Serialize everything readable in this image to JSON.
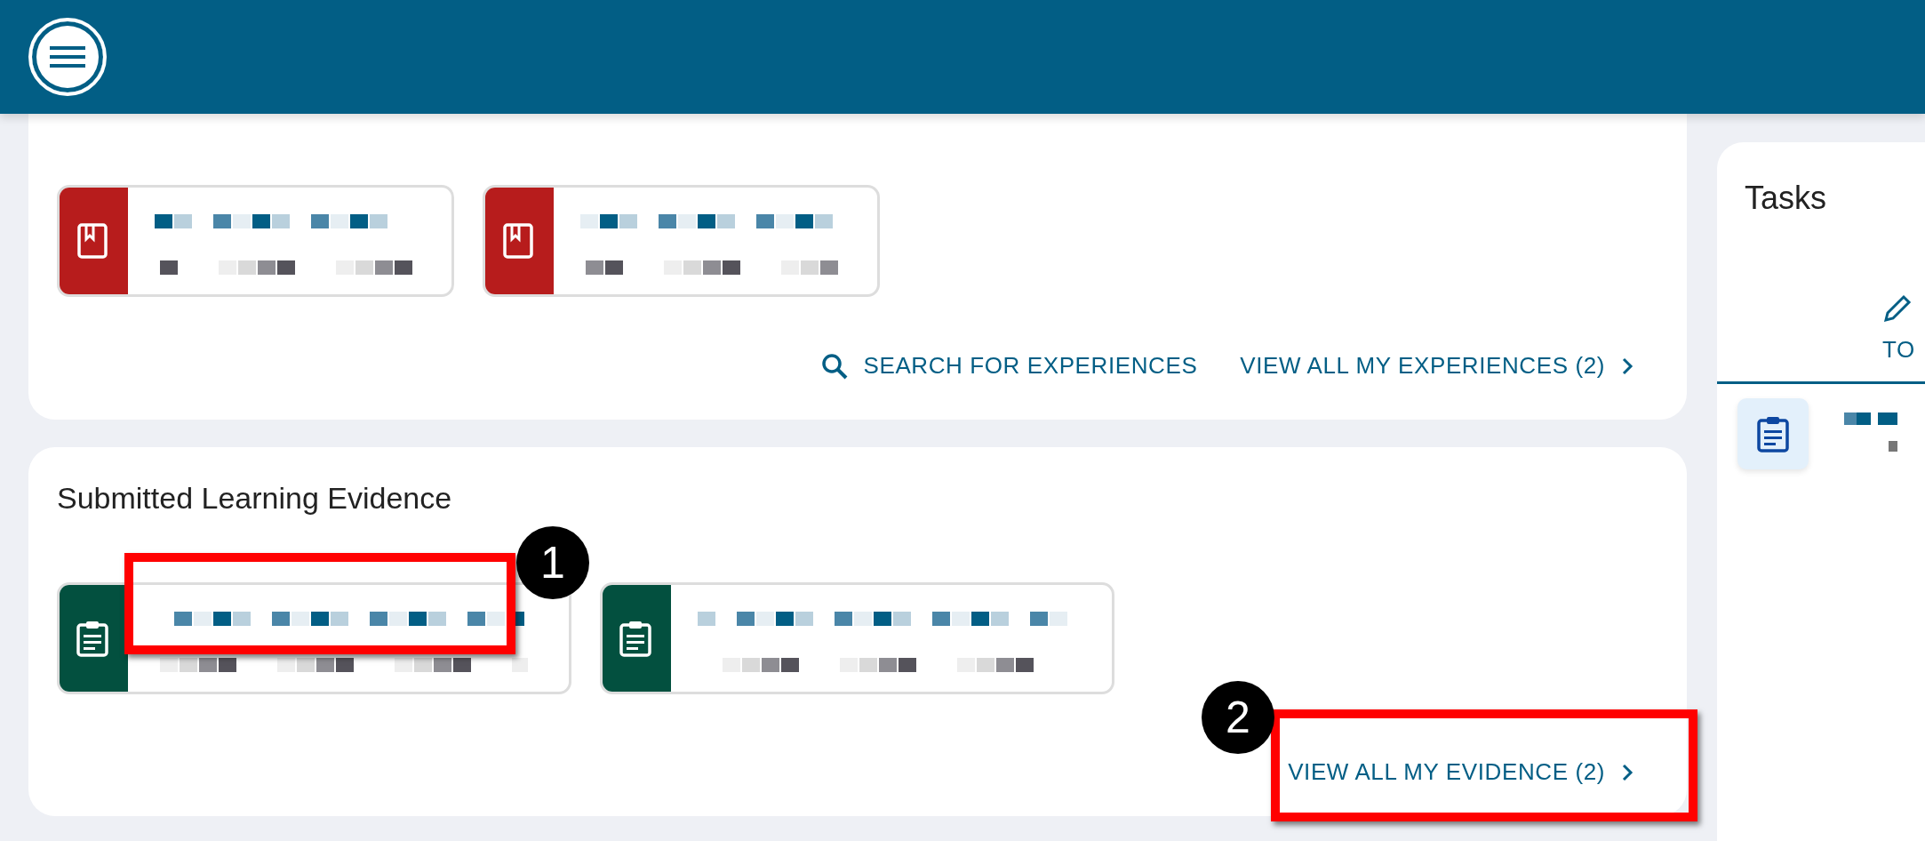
{
  "experiences_section": {
    "cards": [
      {
        "kind": "experience"
      },
      {
        "kind": "experience"
      }
    ],
    "links": [
      {
        "kind": "search",
        "label": "SEARCH FOR EXPERIENCES"
      },
      {
        "kind": "view_all",
        "label": "VIEW ALL MY EXPERIENCES (2)"
      }
    ]
  },
  "evidence_section": {
    "title": "Submitted Learning Evidence",
    "cards": [
      {
        "kind": "evidence"
      },
      {
        "kind": "evidence"
      }
    ],
    "links": [
      {
        "kind": "view_all",
        "label": "VIEW ALL MY EVIDENCE (2)"
      }
    ]
  },
  "tasks_panel": {
    "title": "Tasks",
    "tabs": [
      {
        "label": "TO",
        "selected": true
      }
    ],
    "items": [
      {
        "kind": "task"
      }
    ]
  },
  "annotations": [
    {
      "label": "1"
    },
    {
      "label": "2"
    }
  ]
}
